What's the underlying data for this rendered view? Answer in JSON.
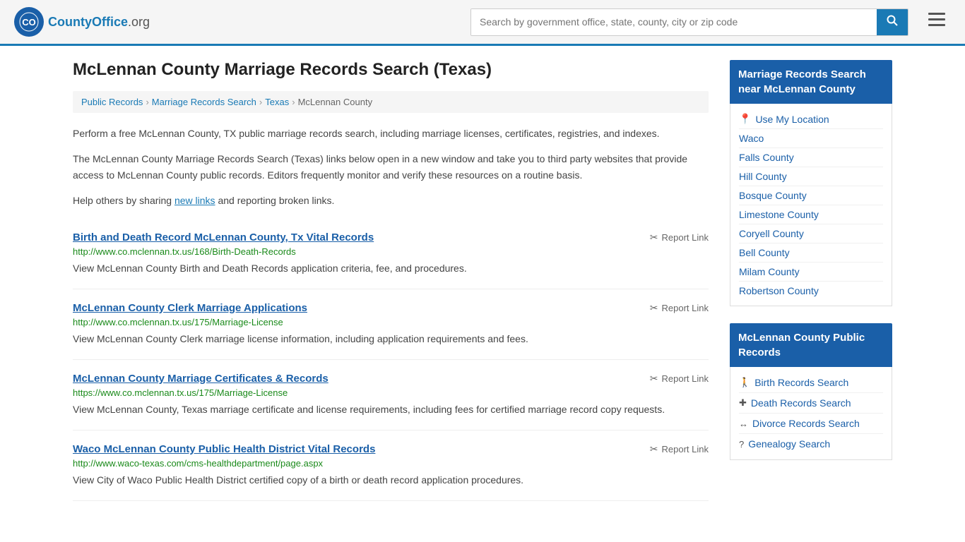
{
  "header": {
    "logo_text": "CountyOffice",
    "logo_tld": ".org",
    "search_placeholder": "Search by government office, state, county, city or zip code"
  },
  "page": {
    "title": "McLennan County Marriage Records Search (Texas)"
  },
  "breadcrumb": {
    "items": [
      {
        "label": "Public Records",
        "href": "#"
      },
      {
        "label": "Marriage Records Search",
        "href": "#"
      },
      {
        "label": "Texas",
        "href": "#"
      },
      {
        "label": "McLennan County",
        "href": "#"
      }
    ]
  },
  "description": {
    "paragraph1": "Perform a free McLennan County, TX public marriage records search, including marriage licenses, certificates, registries, and indexes.",
    "paragraph2": "The McLennan County Marriage Records Search (Texas) links below open in a new window and take you to third party websites that provide access to McLennan County public records. Editors frequently monitor and verify these resources on a routine basis.",
    "paragraph3_prefix": "Help others by sharing ",
    "paragraph3_link": "new links",
    "paragraph3_suffix": " and reporting broken links."
  },
  "results": [
    {
      "title": "Birth and Death Record McLennan County, Tx Vital Records",
      "url": "http://www.co.mclennan.tx.us/168/Birth-Death-Records",
      "desc": "View McLennan County Birth and Death Records application criteria, fee, and procedures.",
      "report_label": "Report Link"
    },
    {
      "title": "McLennan County Clerk Marriage Applications",
      "url": "http://www.co.mclennan.tx.us/175/Marriage-License",
      "desc": "View McLennan County Clerk marriage license information, including application requirements and fees.",
      "report_label": "Report Link"
    },
    {
      "title": "McLennan County Marriage Certificates & Records",
      "url": "https://www.co.mclennan.tx.us/175/Marriage-License",
      "desc": "View McLennan County, Texas marriage certificate and license requirements, including fees for certified marriage record copy requests.",
      "report_label": "Report Link"
    },
    {
      "title": "Waco McLennan County Public Health District Vital Records",
      "url": "http://www.waco-texas.com/cms-healthdepartment/page.aspx",
      "desc": "View City of Waco Public Health District certified copy of a birth or death record application procedures.",
      "report_label": "Report Link"
    }
  ],
  "sidebar": {
    "nearby_section": {
      "header": "Marriage Records Search near McLennan County",
      "use_my_location": "Use My Location",
      "items": [
        {
          "label": "Waco"
        },
        {
          "label": "Falls County"
        },
        {
          "label": "Hill County"
        },
        {
          "label": "Bosque County"
        },
        {
          "label": "Limestone County"
        },
        {
          "label": "Coryell County"
        },
        {
          "label": "Bell County"
        },
        {
          "label": "Milam County"
        },
        {
          "label": "Robertson County"
        }
      ]
    },
    "public_records_section": {
      "header": "McLennan County Public Records",
      "items": [
        {
          "label": "Birth Records Search",
          "icon": "person"
        },
        {
          "label": "Death Records Search",
          "icon": "cross"
        },
        {
          "label": "Divorce Records Search",
          "icon": "arrows"
        },
        {
          "label": "Genealogy Search",
          "icon": "question"
        }
      ]
    }
  }
}
